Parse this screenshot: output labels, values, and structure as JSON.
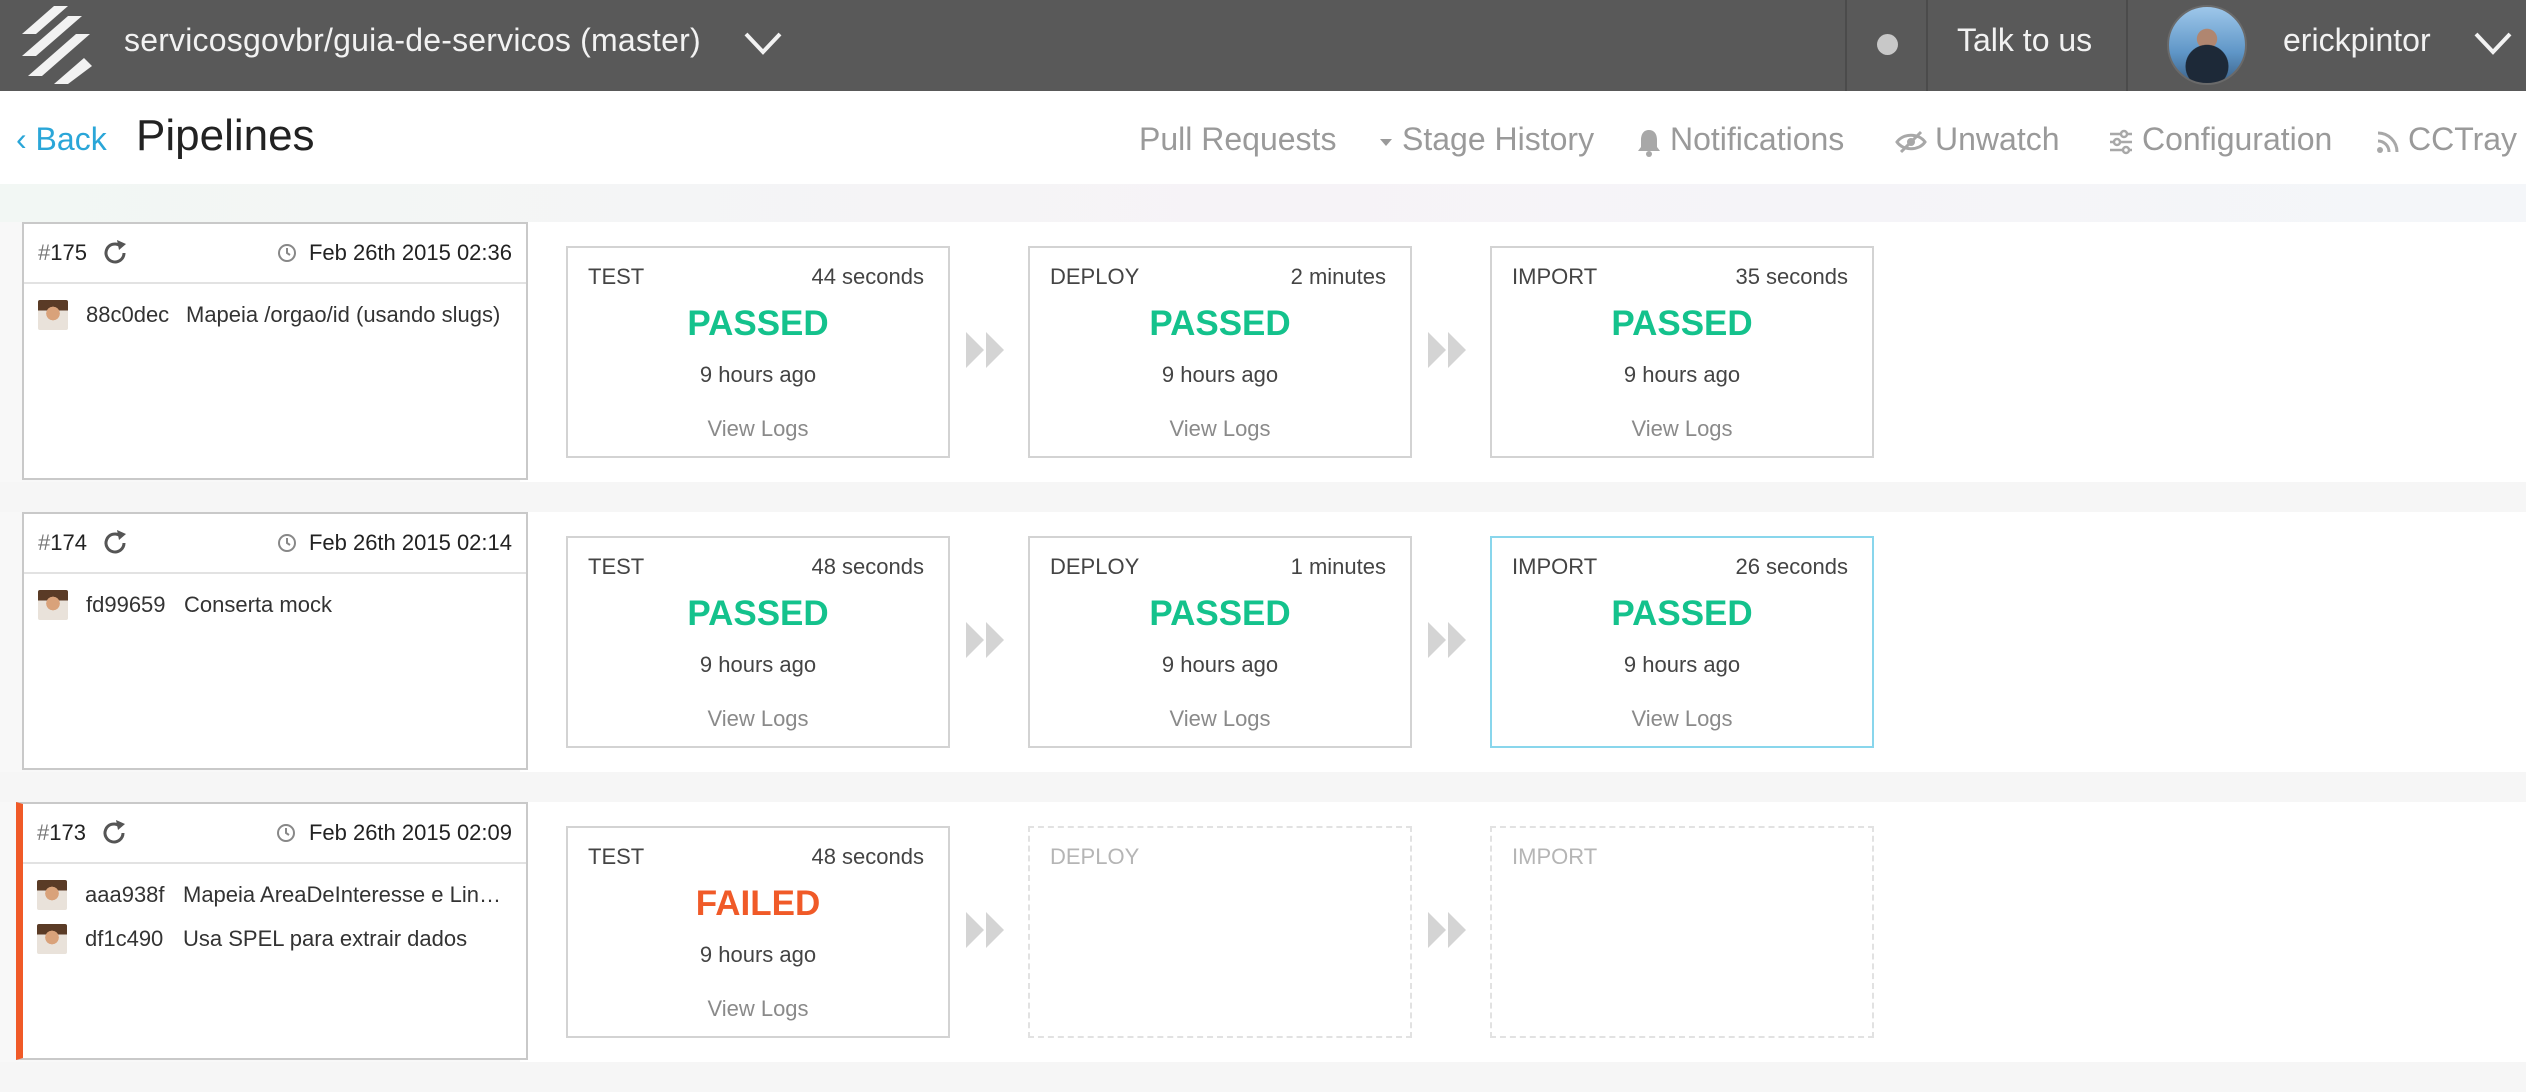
{
  "header": {
    "repo_title": "servicosgovbr/guia-de-servicos (master)",
    "talk_label": "Talk to us",
    "username": "erickpintor"
  },
  "subnav": {
    "back_label": "Back",
    "page_title": "Pipelines",
    "items": {
      "pull_requests": "Pull Requests",
      "stage_history": "Stage History",
      "notifications": "Notifications",
      "unwatch": "Unwatch",
      "configuration": "Configuration",
      "cctray": "CCTray"
    }
  },
  "colors": {
    "topbar": "#595959",
    "link": "#2aa6d8",
    "passed": "#14c28c",
    "failed": "#f05a28",
    "highlight": "#89d6ec"
  },
  "pipelines": [
    {
      "hash": "#",
      "number": "175",
      "date": "Feb 26th 2015 02:36",
      "status": "passed",
      "commits": [
        {
          "sha": "88c0dec",
          "message": "Mapeia /orgao/id (usando slugs)"
        }
      ],
      "stages": [
        {
          "name": "TEST",
          "duration": "44 seconds",
          "status": "PASSED",
          "ago": "9 hours ago",
          "logs": "View Logs"
        },
        {
          "name": "DEPLOY",
          "duration": "2 minutes",
          "status": "PASSED",
          "ago": "9 hours ago",
          "logs": "View Logs"
        },
        {
          "name": "IMPORT",
          "duration": "35 seconds",
          "status": "PASSED",
          "ago": "9 hours ago",
          "logs": "View Logs"
        }
      ]
    },
    {
      "hash": "#",
      "number": "174",
      "date": "Feb 26th 2015 02:14",
      "status": "passed",
      "commits": [
        {
          "sha": "fd99659",
          "message": "Conserta mock"
        }
      ],
      "stages": [
        {
          "name": "TEST",
          "duration": "48 seconds",
          "status": "PASSED",
          "ago": "9 hours ago",
          "logs": "View Logs"
        },
        {
          "name": "DEPLOY",
          "duration": "1 minutes",
          "status": "PASSED",
          "ago": "9 hours ago",
          "logs": "View Logs"
        },
        {
          "name": "IMPORT",
          "duration": "26 seconds",
          "status": "PASSED",
          "ago": "9 hours ago",
          "logs": "View Logs"
        }
      ]
    },
    {
      "hash": "#",
      "number": "173",
      "date": "Feb 26th 2015 02:09",
      "status": "failed",
      "commits": [
        {
          "sha": "aaa938f",
          "message": "Mapeia AreaDeInteresse e Linh…"
        },
        {
          "sha": "df1c490",
          "message": "Usa SPEL para extrair dados"
        }
      ],
      "stages": [
        {
          "name": "TEST",
          "duration": "48 seconds",
          "status": "FAILED",
          "ago": "9 hours ago",
          "logs": "View Logs"
        },
        {
          "name": "DEPLOY"
        },
        {
          "name": "IMPORT"
        }
      ]
    }
  ]
}
